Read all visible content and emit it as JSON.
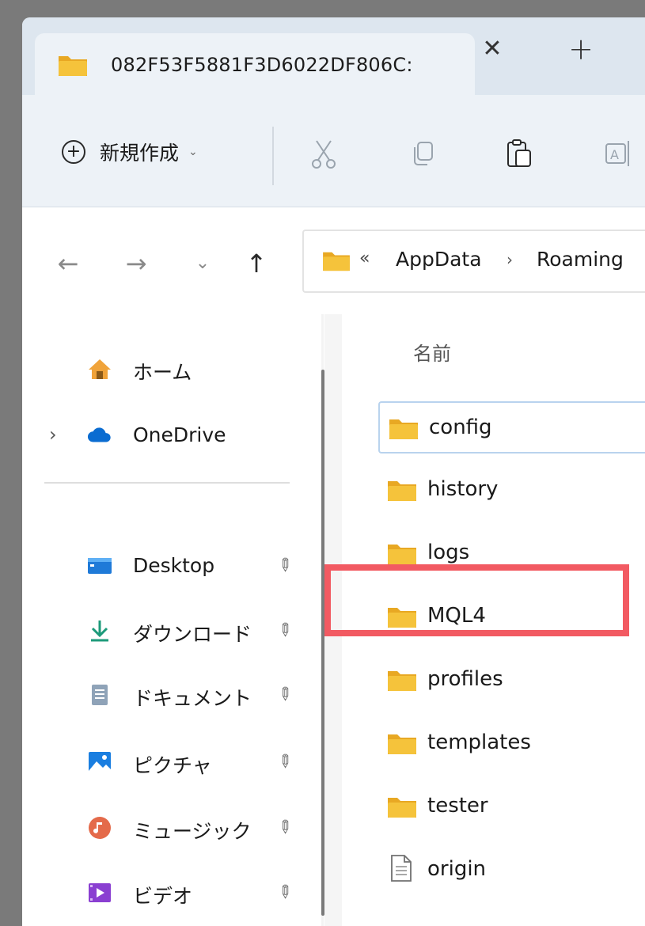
{
  "tab": {
    "title": "082F53F5881F3D6022DF806C:",
    "close_glyph": "✕",
    "add_glyph": "+"
  },
  "toolbar": {
    "new_label": "新規作成",
    "new_caret": "⌄",
    "new_icon": "plus-circle-icon",
    "icons": [
      "cut-icon",
      "copy-icon",
      "paste-icon",
      "rename-icon"
    ]
  },
  "nav": {
    "back": "←",
    "forward": "→",
    "recent": "⌄",
    "up": "↑"
  },
  "address": {
    "overflow": "«",
    "separator": "›",
    "crumbs": [
      "AppData",
      "Roaming"
    ]
  },
  "sidebar": {
    "home_label": "ホーム",
    "onedrive_label": "OneDrive",
    "expand": "›",
    "quick_access": [
      {
        "label": "Desktop",
        "icon": "desktop-icon"
      },
      {
        "label": "ダウンロード",
        "icon": "download-icon"
      },
      {
        "label": "ドキュメント",
        "icon": "documents-icon"
      },
      {
        "label": "ピクチャ",
        "icon": "pictures-icon"
      },
      {
        "label": "ミュージック",
        "icon": "music-icon"
      },
      {
        "label": "ビデオ",
        "icon": "videos-icon"
      }
    ],
    "pin_glyph": "📌"
  },
  "filelist": {
    "column_name": "名前",
    "items": [
      {
        "name": "config",
        "type": "folder"
      },
      {
        "name": "history",
        "type": "folder"
      },
      {
        "name": "logs",
        "type": "folder"
      },
      {
        "name": "MQL4",
        "type": "folder"
      },
      {
        "name": "profiles",
        "type": "folder"
      },
      {
        "name": "templates",
        "type": "folder"
      },
      {
        "name": "tester",
        "type": "folder"
      },
      {
        "name": "origin",
        "type": "file"
      }
    ],
    "highlighted": "MQL4"
  },
  "colors": {
    "folder": "#f5c33b",
    "highlight": "#f25a62",
    "accent": "#0067c0"
  }
}
